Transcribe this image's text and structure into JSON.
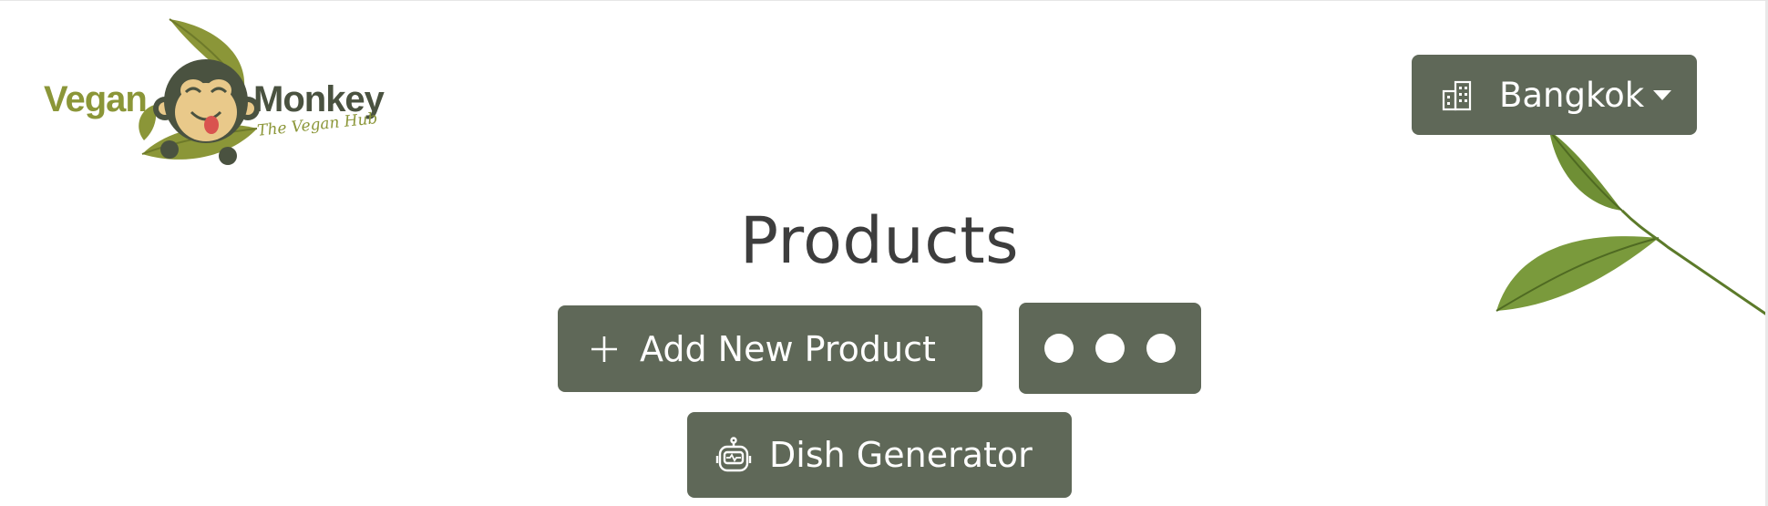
{
  "theme": {
    "button_bg": "#5f6858",
    "logo_olive": "#8b9638",
    "logo_dark": "#4a5240",
    "leaf_green": "#6f8f35"
  },
  "logo": {
    "word_left": "Vegan",
    "word_right": "Monkey",
    "tagline": "The Vegan Hub"
  },
  "header": {
    "city_icon": "building-icon",
    "city": "Bangkok",
    "caret_icon": "caret-down-icon"
  },
  "main": {
    "title": "Products",
    "add_icon": "plus-icon",
    "add_label": "Add New Product",
    "more_icon": "three-dots-icon",
    "dish_icon": "robot-icon",
    "dish_label": "Dish Generator"
  }
}
